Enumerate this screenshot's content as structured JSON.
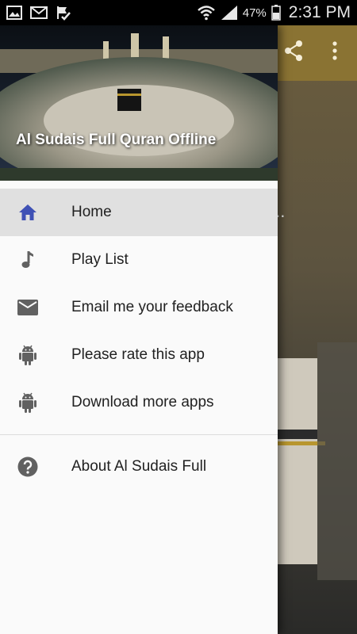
{
  "status_bar": {
    "battery_percent": "47%",
    "time": "2:31 PM",
    "left_icons": [
      "gallery-icon",
      "gmail-icon",
      "check-flag-icon"
    ],
    "right_icons": [
      "wifi-icon",
      "signal-icon",
      "battery-icon"
    ]
  },
  "background_app": {
    "toolbar_color": "#8a7333",
    "partial_text": "k..."
  },
  "drawer": {
    "header_title": "Al Sudais Full Quran Offline",
    "menu": [
      {
        "label": "Home",
        "icon": "home-icon",
        "active": true
      },
      {
        "label": "Play List",
        "icon": "music-note-icon",
        "active": false
      },
      {
        "label": "Email me your feedback",
        "icon": "email-icon",
        "active": false
      },
      {
        "label": "Please rate this app",
        "icon": "android-icon",
        "active": false
      },
      {
        "label": "Download more apps",
        "icon": "android-icon",
        "active": false
      }
    ],
    "footer_menu": [
      {
        "label": "About Al Sudais Full",
        "icon": "help-icon",
        "active": false
      }
    ]
  },
  "colors": {
    "accent_blue": "#3f51b5",
    "icon_grey": "#616161",
    "active_row_bg": "#e0e0e0"
  }
}
